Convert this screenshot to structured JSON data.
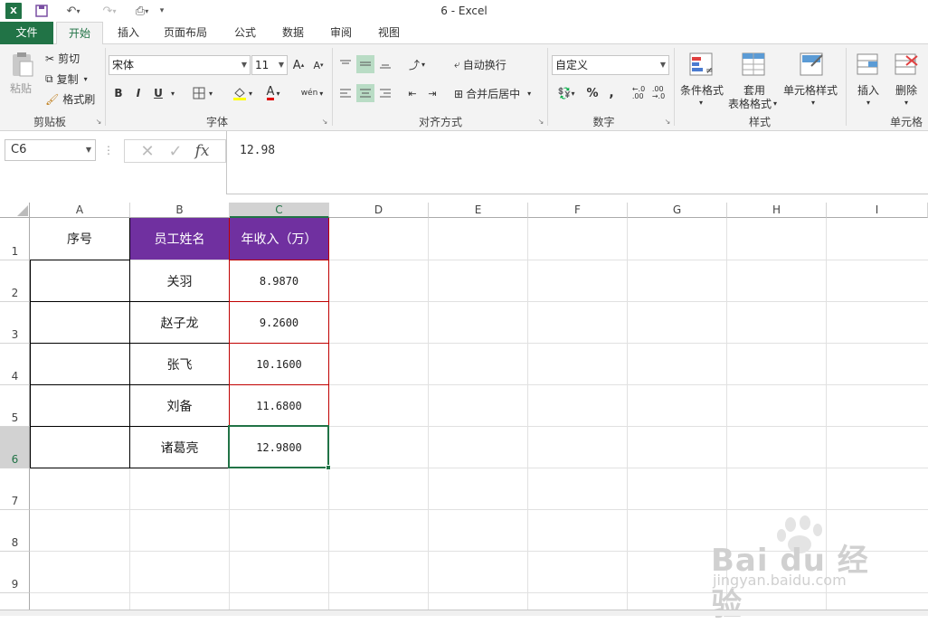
{
  "window": {
    "title": "6 - Excel"
  },
  "tabs": [
    {
      "label": "文件"
    },
    {
      "label": "开始"
    },
    {
      "label": "插入"
    },
    {
      "label": "页面布局"
    },
    {
      "label": "公式"
    },
    {
      "label": "数据"
    },
    {
      "label": "审阅"
    },
    {
      "label": "视图"
    }
  ],
  "ribbon": {
    "clipboard": {
      "paste": "粘贴",
      "cut": "剪切",
      "copy": "复制",
      "format_painter": "格式刷",
      "group": "剪贴板"
    },
    "font": {
      "name": "宋体",
      "size": "11",
      "group": "字体",
      "bold": "B",
      "italic": "I",
      "underline": "U",
      "phonetic": "wén"
    },
    "alignment": {
      "wrap": "自动换行",
      "merge": "合并后居中",
      "group": "对齐方式"
    },
    "number": {
      "format": "自定义",
      "group": "数字",
      "percent": "%",
      "comma": ","
    },
    "styles": {
      "conditional": "条件格式",
      "table_line1": "套用",
      "table_line2": "表格格式",
      "cell_styles": "单元格样式",
      "group": "样式"
    },
    "cells": {
      "insert": "插入",
      "delete": "删除",
      "group": "单元格"
    }
  },
  "formula_bar": {
    "name_box": "C6",
    "formula": "12.98",
    "fx": "fx"
  },
  "columns": [
    "A",
    "B",
    "C",
    "D",
    "E",
    "F",
    "G",
    "H",
    "I"
  ],
  "rows": [
    "1",
    "2",
    "3",
    "4",
    "5",
    "6",
    "7",
    "8",
    "9"
  ],
  "table": {
    "headers": [
      "序号",
      "员工姓名",
      "年收入（万）"
    ],
    "rows": [
      {
        "name": "关羽",
        "income": "8.9870"
      },
      {
        "name": "赵子龙",
        "income": "9.2600"
      },
      {
        "name": "张飞",
        "income": "10.1600"
      },
      {
        "name": "刘备",
        "income": "11.6800"
      },
      {
        "name": "诸葛亮",
        "income": "12.9800"
      }
    ]
  },
  "selected": {
    "cell": "C6",
    "column": "C",
    "row": "6"
  },
  "colors": {
    "accent": "#217346",
    "header_fill": "#7030a0",
    "header_text": "#ffffff",
    "income_border": "#c00000"
  },
  "watermark": {
    "brand": "Bai du 经验",
    "url": "jingyan.baidu.com"
  }
}
